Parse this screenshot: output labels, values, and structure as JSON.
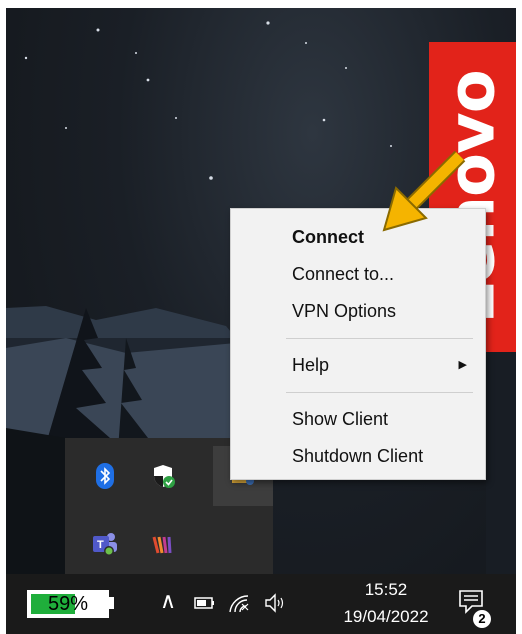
{
  "brand": {
    "text": "Lenovo",
    "color": "#e2231a"
  },
  "context_menu": {
    "items": [
      {
        "label": "Connect",
        "bold": true
      },
      {
        "label": "Connect to..."
      },
      {
        "label": "VPN Options"
      },
      {
        "label": "Help",
        "submenu_arrow": "▶"
      },
      {
        "label": "Show Client"
      },
      {
        "label": "Shutdown Client"
      }
    ]
  },
  "tray_flyout": {
    "icons": [
      "bluetooth-icon",
      "windows-security-icon",
      "vpn-client-icon",
      "teams-icon",
      "winzip-icon"
    ]
  },
  "taskbar": {
    "battery": {
      "percent_label": "59%",
      "level": 0.59,
      "fill_color": "#1fae3b"
    },
    "chevron": "∧",
    "clock": {
      "time": "15:52",
      "date": "19/04/2022"
    },
    "notifications": {
      "count": "2"
    }
  },
  "annotation": {
    "arrow_color": "#f5b400"
  }
}
